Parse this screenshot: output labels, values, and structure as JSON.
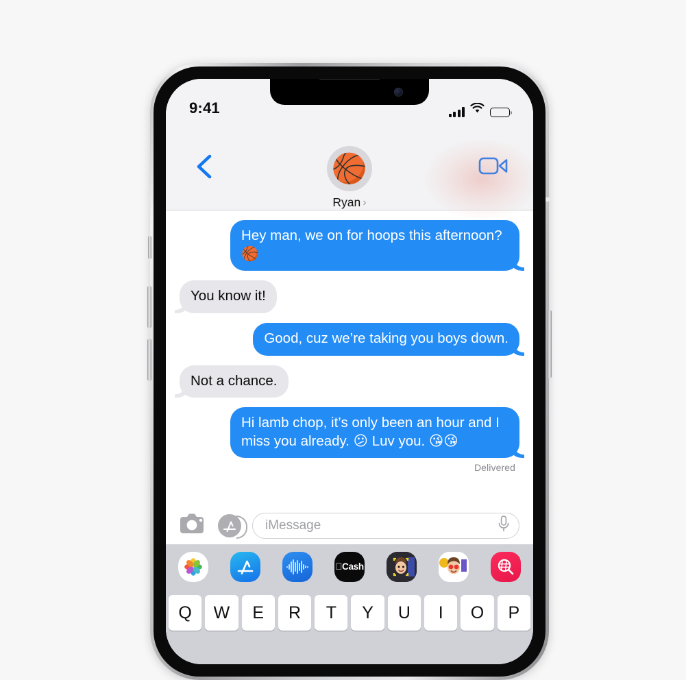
{
  "device": {
    "model_frame": "iphone",
    "buttons": {
      "ringer": "ringer-switch",
      "volume_up": "volume-up-button",
      "volume_down": "volume-down-button",
      "power": "side-power-button"
    }
  },
  "status_bar": {
    "time": "9:41",
    "cellular": "cellular-signal-4-bars",
    "wifi": "wifi-icon",
    "battery": "battery-full-icon",
    "battery_level": 100
  },
  "nav": {
    "back_label": "back-chevron",
    "contact_name": "Ryan",
    "contact_chevron": "›",
    "avatar_emoji": "🏀",
    "facetime_label": "facetime-video-button"
  },
  "conversation": {
    "messages": [
      {
        "id": 1,
        "side": "out",
        "text": "Hey man, we on for hoops this afternoon? 🏀"
      },
      {
        "id": 2,
        "side": "in",
        "text": "You know it!"
      },
      {
        "id": 3,
        "side": "out",
        "text": "Good, cuz we’re taking you boys down."
      },
      {
        "id": 4,
        "side": "in",
        "text": "Not a chance."
      },
      {
        "id": 5,
        "side": "out",
        "text": "Hi lamb chop, it’s only been an hour and I miss you already. 😕 Luv you. 😘😘"
      }
    ],
    "delivery_status": "Delivered"
  },
  "input_bar": {
    "camera_label": "camera-button",
    "appstore_label": "app-store-button",
    "placeholder": "iMessage",
    "value": "",
    "mic_label": "microphone-button"
  },
  "app_drawer": {
    "apps": [
      {
        "name": "photos-app-icon",
        "label": "Photos"
      },
      {
        "name": "appstore-app-icon",
        "label": "App Store"
      },
      {
        "name": "audio-app-icon",
        "label": "Audio Message"
      },
      {
        "name": "applecash-app-icon",
        "label": "Cash"
      },
      {
        "name": "memoji-app-icon",
        "label": "Memoji"
      },
      {
        "name": "memoji-stickers-app-icon",
        "label": "Memoji Stickers"
      },
      {
        "name": "images-search-app-icon",
        "label": "#images"
      }
    ]
  },
  "keyboard": {
    "row_1": [
      "Q",
      "W",
      "E",
      "R",
      "T",
      "Y",
      "U",
      "I",
      "O",
      "P"
    ]
  },
  "colors": {
    "bubble_out": "#238cf5",
    "bubble_in": "#e6e6eb",
    "accent_blue": "#1478f0",
    "header_bg": "#f3f3f5",
    "keyboard_bg": "#cfd1d7",
    "page_bg": "#f7f7f7"
  }
}
